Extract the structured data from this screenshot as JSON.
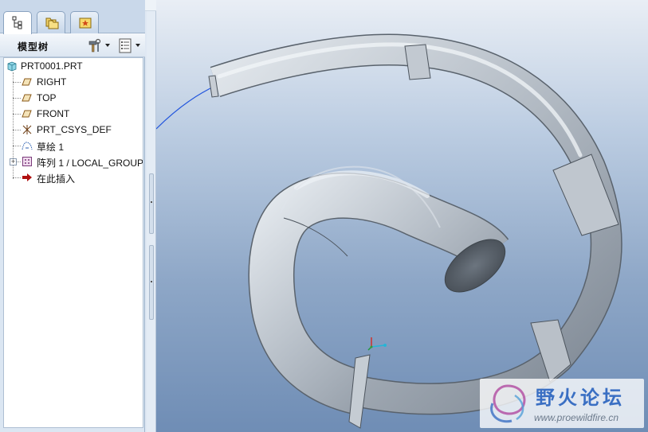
{
  "tabs": [
    {
      "icon": "model-tree-icon",
      "active": true
    },
    {
      "icon": "folder-browser-icon",
      "active": false
    },
    {
      "icon": "favorites-icon",
      "active": false
    }
  ],
  "model_tree": {
    "title": "模型树",
    "settings_icon": "hammer-settings-icon",
    "show_icon": "tree-columns-icon"
  },
  "tree": {
    "root": {
      "label": "PRT0001.PRT",
      "icon": "part-icon"
    },
    "items": [
      {
        "label": "RIGHT",
        "icon": "datum-plane-icon"
      },
      {
        "label": "TOP",
        "icon": "datum-plane-icon"
      },
      {
        "label": "FRONT",
        "icon": "datum-plane-icon"
      },
      {
        "label": "PRT_CSYS_DEF",
        "icon": "coordinate-system-icon"
      },
      {
        "label": "草绘 1",
        "icon": "sketch-icon"
      },
      {
        "label": "阵列 1 / LOCAL_GROUP",
        "icon": "pattern-icon",
        "expandable": true
      },
      {
        "label": "在此插入",
        "icon": "insert-here-arrow-icon"
      }
    ]
  },
  "watermark": {
    "title": "野火论坛",
    "url": "www.proewildfire.cn"
  },
  "colors": {
    "panel_bg": "#dbe6f2",
    "viewport_top": "#e9eef5",
    "viewport_bottom": "#6f8db5",
    "model_gray": "#b7bfc7",
    "curve_blue": "#2255dd",
    "insert_arrow": "#b01010"
  }
}
